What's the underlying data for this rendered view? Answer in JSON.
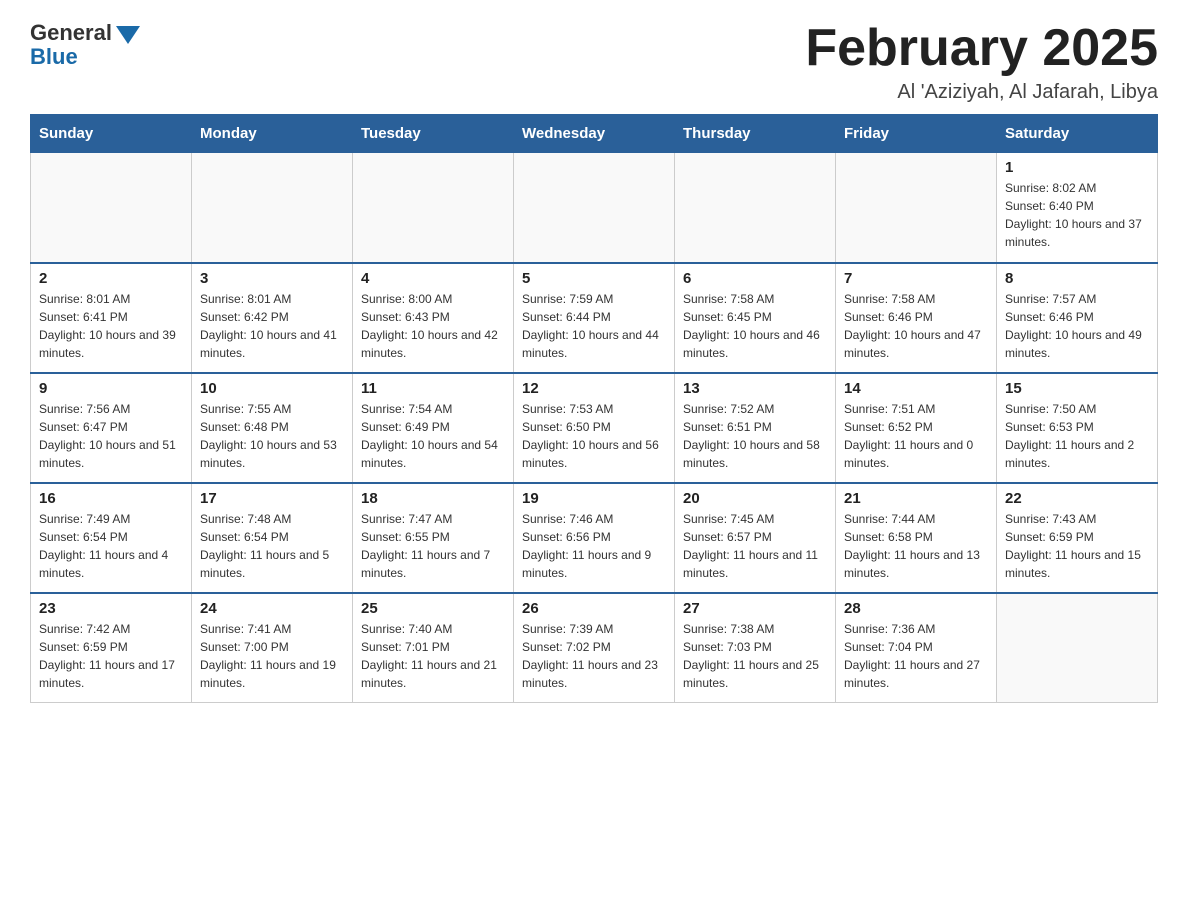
{
  "logo": {
    "general": "General",
    "blue": "Blue"
  },
  "header": {
    "title": "February 2025",
    "subtitle": "Al 'Aziziyah, Al Jafarah, Libya"
  },
  "days_of_week": [
    "Sunday",
    "Monday",
    "Tuesday",
    "Wednesday",
    "Thursday",
    "Friday",
    "Saturday"
  ],
  "weeks": [
    [
      {
        "day": "",
        "info": ""
      },
      {
        "day": "",
        "info": ""
      },
      {
        "day": "",
        "info": ""
      },
      {
        "day": "",
        "info": ""
      },
      {
        "day": "",
        "info": ""
      },
      {
        "day": "",
        "info": ""
      },
      {
        "day": "1",
        "info": "Sunrise: 8:02 AM\nSunset: 6:40 PM\nDaylight: 10 hours and 37 minutes."
      }
    ],
    [
      {
        "day": "2",
        "info": "Sunrise: 8:01 AM\nSunset: 6:41 PM\nDaylight: 10 hours and 39 minutes."
      },
      {
        "day": "3",
        "info": "Sunrise: 8:01 AM\nSunset: 6:42 PM\nDaylight: 10 hours and 41 minutes."
      },
      {
        "day": "4",
        "info": "Sunrise: 8:00 AM\nSunset: 6:43 PM\nDaylight: 10 hours and 42 minutes."
      },
      {
        "day": "5",
        "info": "Sunrise: 7:59 AM\nSunset: 6:44 PM\nDaylight: 10 hours and 44 minutes."
      },
      {
        "day": "6",
        "info": "Sunrise: 7:58 AM\nSunset: 6:45 PM\nDaylight: 10 hours and 46 minutes."
      },
      {
        "day": "7",
        "info": "Sunrise: 7:58 AM\nSunset: 6:46 PM\nDaylight: 10 hours and 47 minutes."
      },
      {
        "day": "8",
        "info": "Sunrise: 7:57 AM\nSunset: 6:46 PM\nDaylight: 10 hours and 49 minutes."
      }
    ],
    [
      {
        "day": "9",
        "info": "Sunrise: 7:56 AM\nSunset: 6:47 PM\nDaylight: 10 hours and 51 minutes."
      },
      {
        "day": "10",
        "info": "Sunrise: 7:55 AM\nSunset: 6:48 PM\nDaylight: 10 hours and 53 minutes."
      },
      {
        "day": "11",
        "info": "Sunrise: 7:54 AM\nSunset: 6:49 PM\nDaylight: 10 hours and 54 minutes."
      },
      {
        "day": "12",
        "info": "Sunrise: 7:53 AM\nSunset: 6:50 PM\nDaylight: 10 hours and 56 minutes."
      },
      {
        "day": "13",
        "info": "Sunrise: 7:52 AM\nSunset: 6:51 PM\nDaylight: 10 hours and 58 minutes."
      },
      {
        "day": "14",
        "info": "Sunrise: 7:51 AM\nSunset: 6:52 PM\nDaylight: 11 hours and 0 minutes."
      },
      {
        "day": "15",
        "info": "Sunrise: 7:50 AM\nSunset: 6:53 PM\nDaylight: 11 hours and 2 minutes."
      }
    ],
    [
      {
        "day": "16",
        "info": "Sunrise: 7:49 AM\nSunset: 6:54 PM\nDaylight: 11 hours and 4 minutes."
      },
      {
        "day": "17",
        "info": "Sunrise: 7:48 AM\nSunset: 6:54 PM\nDaylight: 11 hours and 5 minutes."
      },
      {
        "day": "18",
        "info": "Sunrise: 7:47 AM\nSunset: 6:55 PM\nDaylight: 11 hours and 7 minutes."
      },
      {
        "day": "19",
        "info": "Sunrise: 7:46 AM\nSunset: 6:56 PM\nDaylight: 11 hours and 9 minutes."
      },
      {
        "day": "20",
        "info": "Sunrise: 7:45 AM\nSunset: 6:57 PM\nDaylight: 11 hours and 11 minutes."
      },
      {
        "day": "21",
        "info": "Sunrise: 7:44 AM\nSunset: 6:58 PM\nDaylight: 11 hours and 13 minutes."
      },
      {
        "day": "22",
        "info": "Sunrise: 7:43 AM\nSunset: 6:59 PM\nDaylight: 11 hours and 15 minutes."
      }
    ],
    [
      {
        "day": "23",
        "info": "Sunrise: 7:42 AM\nSunset: 6:59 PM\nDaylight: 11 hours and 17 minutes."
      },
      {
        "day": "24",
        "info": "Sunrise: 7:41 AM\nSunset: 7:00 PM\nDaylight: 11 hours and 19 minutes."
      },
      {
        "day": "25",
        "info": "Sunrise: 7:40 AM\nSunset: 7:01 PM\nDaylight: 11 hours and 21 minutes."
      },
      {
        "day": "26",
        "info": "Sunrise: 7:39 AM\nSunset: 7:02 PM\nDaylight: 11 hours and 23 minutes."
      },
      {
        "day": "27",
        "info": "Sunrise: 7:38 AM\nSunset: 7:03 PM\nDaylight: 11 hours and 25 minutes."
      },
      {
        "day": "28",
        "info": "Sunrise: 7:36 AM\nSunset: 7:04 PM\nDaylight: 11 hours and 27 minutes."
      },
      {
        "day": "",
        "info": ""
      }
    ]
  ]
}
